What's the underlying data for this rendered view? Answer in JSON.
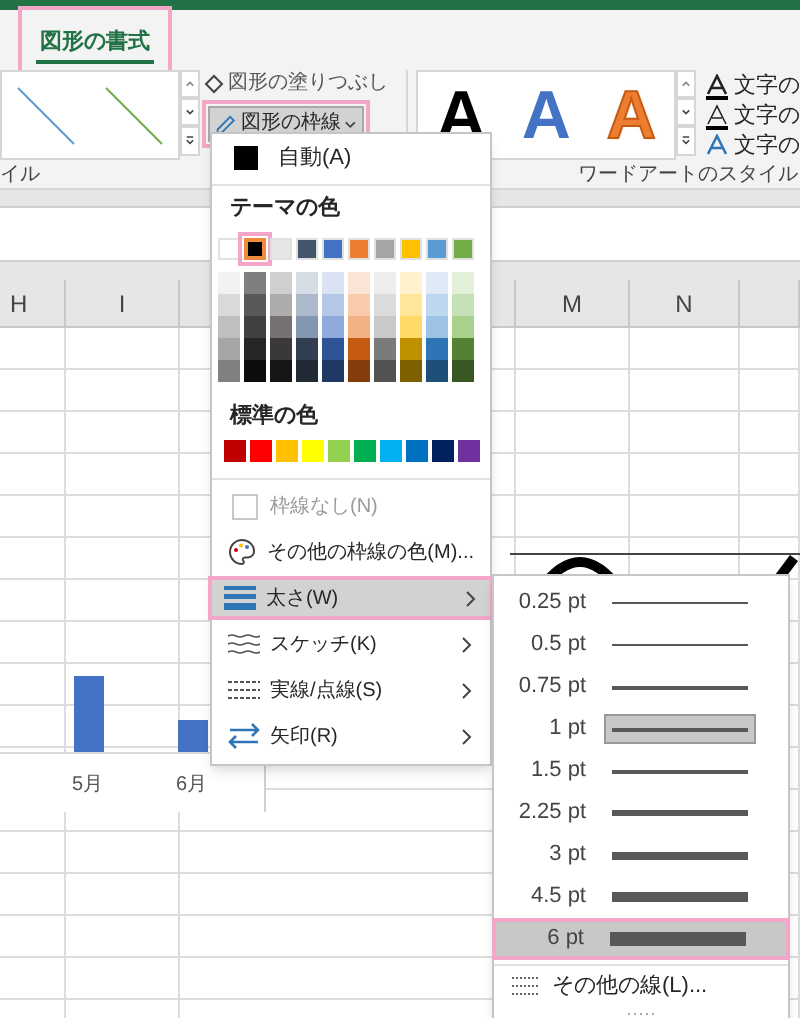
{
  "ribbon": {
    "tab": {
      "label": "図形の書式",
      "selected": true,
      "marked": true
    },
    "fill_button": {
      "label": "図形の塗りつぶし"
    },
    "outline_button": {
      "label": "図形の枠線",
      "expanded": true,
      "marked": true
    },
    "wordart_styles": [
      {
        "text": "A",
        "kind": "fill",
        "color": "#000000"
      },
      {
        "text": "A",
        "kind": "fill",
        "color": "#4472c4"
      },
      {
        "text": "A",
        "kind": "outline",
        "color": "#ed7d31"
      }
    ],
    "text_buttons": [
      {
        "label": "文字の",
        "kind": "fill"
      },
      {
        "label": "文字の",
        "kind": "outline"
      },
      {
        "label": "文字の",
        "kind": "effect"
      }
    ],
    "group_labels": [
      "イル",
      "ワードアートのスタイル"
    ]
  },
  "sheet": {
    "columns": [
      "H",
      "I",
      "M",
      "N"
    ],
    "chart": {
      "categories": [
        "5月",
        "6月"
      ]
    }
  },
  "outline_menu": {
    "auto": "自動(A)",
    "theme_heading": "テーマの色",
    "theme_colors": [
      {
        "color": "#ffffff",
        "selected": false,
        "marked": false,
        "tints": [
          {
            "color": "#f2f2f2"
          },
          {
            "color": "#d9d9d9"
          },
          {
            "color": "#bfbfbf"
          },
          {
            "color": "#a6a6a6"
          },
          {
            "color": "#808080"
          }
        ]
      },
      {
        "color": "#000000",
        "selected": true,
        "marked": true,
        "tints": [
          {
            "color": "#7f7f7f"
          },
          {
            "color": "#595959"
          },
          {
            "color": "#404040"
          },
          {
            "color": "#262626"
          },
          {
            "color": "#0d0d0d"
          }
        ]
      },
      {
        "color": "#e7e6e6",
        "selected": false,
        "marked": false,
        "tints": [
          {
            "color": "#d0cece"
          },
          {
            "color": "#aeabab"
          },
          {
            "color": "#757171"
          },
          {
            "color": "#3a3838"
          },
          {
            "color": "#171616"
          }
        ]
      },
      {
        "color": "#44546a",
        "selected": false,
        "marked": false,
        "tints": [
          {
            "color": "#d6dce5"
          },
          {
            "color": "#adb9ca"
          },
          {
            "color": "#8497b0"
          },
          {
            "color": "#333f50"
          },
          {
            "color": "#222a35"
          }
        ]
      },
      {
        "color": "#4472c4",
        "selected": false,
        "marked": false,
        "tints": [
          {
            "color": "#dae3f3"
          },
          {
            "color": "#b4c7e7"
          },
          {
            "color": "#8faadc"
          },
          {
            "color": "#2f5597"
          },
          {
            "color": "#203864"
          }
        ]
      },
      {
        "color": "#ed7d31",
        "selected": false,
        "marked": false,
        "tints": [
          {
            "color": "#fbe5d6"
          },
          {
            "color": "#f8cbad"
          },
          {
            "color": "#f4b183"
          },
          {
            "color": "#c55a11"
          },
          {
            "color": "#843c0c"
          }
        ]
      },
      {
        "color": "#a5a5a5",
        "selected": false,
        "marked": false,
        "tints": [
          {
            "color": "#ededed"
          },
          {
            "color": "#dbdbdb"
          },
          {
            "color": "#c9c9c9"
          },
          {
            "color": "#7b7b7b"
          },
          {
            "color": "#525252"
          }
        ]
      },
      {
        "color": "#ffc000",
        "selected": false,
        "marked": false,
        "tints": [
          {
            "color": "#fff2cc"
          },
          {
            "color": "#ffe699"
          },
          {
            "color": "#ffd966"
          },
          {
            "color": "#bf9000"
          },
          {
            "color": "#7f6000"
          }
        ]
      },
      {
        "color": "#5b9bd5",
        "selected": false,
        "marked": false,
        "tints": [
          {
            "color": "#deebf7"
          },
          {
            "color": "#bdd7ee"
          },
          {
            "color": "#9dc3e6"
          },
          {
            "color": "#2e75b6"
          },
          {
            "color": "#1f4e79"
          }
        ]
      },
      {
        "color": "#70ad47",
        "selected": false,
        "marked": false,
        "tints": [
          {
            "color": "#e2f0d9"
          },
          {
            "color": "#c5e0b4"
          },
          {
            "color": "#a9d18e"
          },
          {
            "color": "#548235"
          },
          {
            "color": "#385723"
          }
        ]
      }
    ],
    "standard_heading": "標準の色",
    "standard_colors": [
      {
        "color": "#c00000"
      },
      {
        "color": "#ff0000"
      },
      {
        "color": "#ffc000"
      },
      {
        "color": "#ffff00"
      },
      {
        "color": "#92d050"
      },
      {
        "color": "#00b050"
      },
      {
        "color": "#00b0f0"
      },
      {
        "color": "#0070c0"
      },
      {
        "color": "#002060"
      },
      {
        "color": "#7030a0"
      }
    ],
    "items": [
      {
        "kind": "none",
        "label": "枠線なし(N)",
        "disabled": true,
        "highlighted": false,
        "submenu": false,
        "marked": false
      },
      {
        "kind": "more",
        "label": "その他の枠線の色(M)...",
        "disabled": false,
        "highlighted": false,
        "submenu": false,
        "marked": false
      },
      {
        "kind": "weight",
        "label": "太さ(W)",
        "disabled": false,
        "highlighted": true,
        "submenu": true,
        "marked": true
      },
      {
        "kind": "sketch",
        "label": "スケッチ(K)",
        "disabled": false,
        "highlighted": false,
        "submenu": true,
        "marked": false
      },
      {
        "kind": "dash",
        "label": "実線/点線(S)",
        "disabled": false,
        "highlighted": false,
        "submenu": true,
        "marked": false
      },
      {
        "kind": "arrow",
        "label": "矢印(R)",
        "disabled": false,
        "highlighted": false,
        "submenu": true,
        "marked": false
      }
    ]
  },
  "weight_menu": {
    "items": [
      {
        "label": "0.25 pt",
        "selected": false,
        "highlighted": false,
        "marked": false
      },
      {
        "label": "0.5 pt",
        "selected": false,
        "highlighted": false,
        "marked": false
      },
      {
        "label": "0.75 pt",
        "selected": false,
        "highlighted": false,
        "marked": false
      },
      {
        "label": "1 pt",
        "selected": true,
        "highlighted": false,
        "marked": false
      },
      {
        "label": "1.5 pt",
        "selected": false,
        "highlighted": false,
        "marked": false
      },
      {
        "label": "2.25 pt",
        "selected": false,
        "highlighted": false,
        "marked": false
      },
      {
        "label": "3 pt",
        "selected": false,
        "highlighted": false,
        "marked": false
      },
      {
        "label": "4.5 pt",
        "selected": false,
        "highlighted": false,
        "marked": false
      },
      {
        "label": "6 pt",
        "selected": false,
        "highlighted": true,
        "marked": true
      }
    ],
    "more": "その他の線(L)..."
  }
}
